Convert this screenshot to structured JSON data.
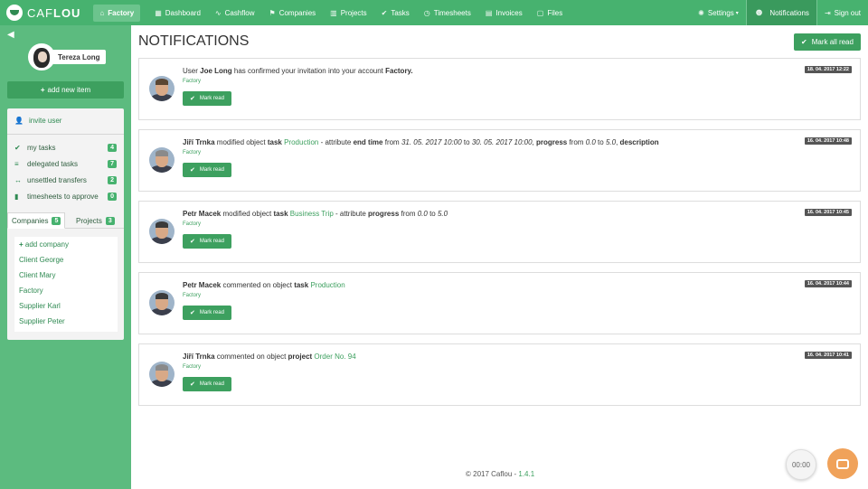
{
  "app": {
    "logo_text_1": "CAF",
    "logo_text_2": "LOU",
    "company_button": "Factory"
  },
  "nav": {
    "items": [
      {
        "label": "Dashboard",
        "icon": "▦"
      },
      {
        "label": "Cashflow",
        "icon": "∿"
      },
      {
        "label": "Companies",
        "icon": "⚑"
      },
      {
        "label": "Projects",
        "icon": "▥"
      },
      {
        "label": "Tasks",
        "icon": "✔"
      },
      {
        "label": "Timesheets",
        "icon": "◷"
      },
      {
        "label": "Invoices",
        "icon": "▤"
      },
      {
        "label": "Files",
        "icon": "▢"
      }
    ],
    "settings": "Settings",
    "notifications": "Notifications",
    "signout": "Sign out"
  },
  "sidebar": {
    "user_name": "Tereza Long",
    "add_item": "add new item",
    "invite": "invite user",
    "tasks": [
      {
        "label": "my tasks",
        "count": "4"
      },
      {
        "label": "delegated tasks",
        "count": "7"
      },
      {
        "label": "unsettled transfers",
        "count": "2"
      },
      {
        "label": "timesheets to approve",
        "count": "0"
      }
    ],
    "tabs": [
      {
        "label": "Companies",
        "count": "5"
      },
      {
        "label": "Projects",
        "count": "3"
      }
    ],
    "add_company": "add company",
    "companies": [
      "Client George",
      "Client Mary",
      "Factory",
      "Supplier Karl",
      "Supplier Peter"
    ]
  },
  "main": {
    "title": "NOTIFICATIONS",
    "mark_all": "Mark all read",
    "mark_read": "Mark read",
    "notifications": [
      {
        "date": "18. 04. 2017 12:22",
        "sub": "Factory",
        "p": [
          "User ",
          "Joe Long",
          " has confirmed your invitation into your account ",
          "Factory."
        ]
      },
      {
        "date": "16. 04. 2017 10:48",
        "sub": "Factory",
        "p": [
          "Jiří Trnka",
          " modified object ",
          "task",
          "Production",
          " - attribute ",
          "end time",
          " from ",
          "31. 05. 2017 10:00",
          " to ",
          "30. 05. 2017 10:00",
          ", ",
          "progress",
          " from ",
          "0.0",
          " to ",
          "5.0",
          ", ",
          "description"
        ]
      },
      {
        "date": "16. 04. 2017 10:45",
        "sub": "Factory",
        "p": [
          "Petr Macek",
          " modified object ",
          "task",
          "Business Trip",
          " - attribute ",
          "progress",
          " from ",
          "0.0",
          " to ",
          "5.0"
        ]
      },
      {
        "date": "16. 04. 2017 10:44",
        "sub": "Factory",
        "p": [
          "Petr Macek",
          " commented on object ",
          "task",
          "Production"
        ]
      },
      {
        "date": "16. 04. 2017 10:41",
        "sub": "Factory",
        "p": [
          "Jiří Trnka",
          " commented on object ",
          "project",
          "Order No. 94"
        ]
      }
    ]
  },
  "footer": {
    "copyright": "© 2017 Caflou - ",
    "version": "1.4.1"
  },
  "timer": "00:00",
  "colors": {
    "brand": "#47b26f",
    "accent": "#3da05f"
  }
}
